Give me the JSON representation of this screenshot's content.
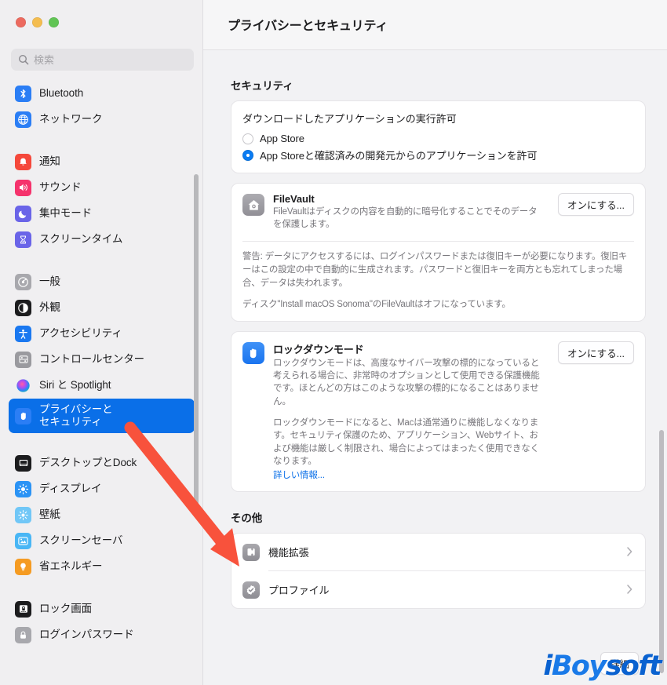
{
  "window": {
    "traffic_lights": [
      "close",
      "minimize",
      "maximize"
    ]
  },
  "sidebar": {
    "search": {
      "placeholder": "検索",
      "value": "",
      "icon": "search-icon"
    },
    "groups": [
      {
        "items": [
          {
            "label": "Bluetooth",
            "icon": "bluetooth-icon",
            "color": "#2b7ef5",
            "selected": false
          },
          {
            "label": "ネットワーク",
            "icon": "network-globe-icon",
            "color": "#2b7ef5",
            "selected": false
          }
        ]
      },
      {
        "items": [
          {
            "label": "通知",
            "icon": "bell-icon",
            "color": "#f5483b",
            "selected": false
          },
          {
            "label": "サウンド",
            "icon": "speaker-icon",
            "color": "#f5326c",
            "selected": false
          },
          {
            "label": "集中モード",
            "icon": "moon-icon",
            "color": "#6a64e8",
            "selected": false
          },
          {
            "label": "スクリーンタイム",
            "icon": "hourglass-icon",
            "color": "#6a64e8",
            "selected": false
          }
        ]
      },
      {
        "items": [
          {
            "label": "一般",
            "icon": "gear-icon",
            "color": "#a8a8ad",
            "selected": false
          },
          {
            "label": "外観",
            "icon": "appearance-icon",
            "color": "#1c1c1e",
            "selected": false
          },
          {
            "label": "アクセシビリティ",
            "icon": "accessibility-icon",
            "color": "#1a78f0",
            "selected": false
          },
          {
            "label": "コントロールセンター",
            "icon": "control-center-icon",
            "color": "#9a9a9f",
            "selected": false
          },
          {
            "label": "Siri と Spotlight",
            "icon": "siri-icon",
            "color": "#4a2a6a",
            "selected": false
          },
          {
            "label": "プライバシーと\nセキュリティ",
            "icon": "privacy-hand-icon",
            "color": "#2b7ef5",
            "selected": true
          }
        ]
      },
      {
        "items": [
          {
            "label": "デスクトップとDock",
            "icon": "desktop-dock-icon",
            "color": "#1c1c1e",
            "selected": false
          },
          {
            "label": "ディスプレイ",
            "icon": "display-icon",
            "color": "#2b93f5",
            "selected": false
          },
          {
            "label": "壁紙",
            "icon": "wallpaper-icon",
            "color": "#71c7f7",
            "selected": false
          },
          {
            "label": "スクリーンセーバ",
            "icon": "screensaver-icon",
            "color": "#49b6f5",
            "selected": false
          },
          {
            "label": "省エネルギー",
            "icon": "lightbulb-icon",
            "color": "#f59b22",
            "selected": false
          }
        ]
      },
      {
        "items": [
          {
            "label": "ロック画面",
            "icon": "lock-screen-icon",
            "color": "#1c1c1e",
            "selected": false
          },
          {
            "label": "ログインパスワード",
            "icon": "password-lock-icon",
            "color": "#a8a8ad",
            "selected": false
          }
        ]
      }
    ]
  },
  "main": {
    "title": "プライバシーとセキュリティ",
    "security_section": {
      "heading": "セキュリティ",
      "gatekeeper": {
        "title": "ダウンロードしたアプリケーションの実行許可",
        "options": [
          {
            "label": "App Store",
            "selected": false
          },
          {
            "label": "App Storeと確認済みの開発元からのアプリケーションを許可",
            "selected": true
          }
        ]
      },
      "filevault": {
        "icon": "filevault-house-icon",
        "name": "FileVault",
        "description": "FileVaultはディスクの内容を自動的に暗号化することでそのデータを保護します。",
        "button": "オンにする...",
        "notes": [
          "警告: データにアクセスするには、ログインパスワードまたは復旧キーが必要になります。復旧キーはこの設定の中で自動的に生成されます。パスワードと復旧キーを両方とも忘れてしまった場合、データは失われます。",
          "ディスク\"Install macOS Sonoma\"のFileVaultはオフになっています。"
        ]
      },
      "lockdown": {
        "icon": "lockdown-hand-icon",
        "name": "ロックダウンモード",
        "description": "ロックダウンモードは、高度なサイバー攻撃の標的になっていると考えられる場合に、非常時のオプションとして使用できる保護機能です。ほとんどの方はこのような攻撃の標的になることはありません。",
        "description2": "ロックダウンモードになると、Macは通常通りに機能しなくなります。セキュリティ保護のため、アプリケーション、Webサイト、および機能は厳しく制限され、場合によってはまったく使用できなくなります。",
        "link": "詳しい情報...",
        "button": "オンにする..."
      }
    },
    "others_section": {
      "heading": "その他",
      "rows": [
        {
          "label": "機能拡張",
          "icon": "extension-puzzle-icon",
          "chevron": "chevron-right-icon"
        },
        {
          "label": "プロファイル",
          "icon": "profile-check-icon",
          "chevron": "chevron-right-icon"
        }
      ]
    },
    "detail_button": "詳細"
  },
  "annotation": {
    "arrow_color": "#f8523c",
    "target": "機能拡張"
  },
  "watermark": {
    "text_i": "i",
    "text_boy": "Boy",
    "text_soft": "soft",
    "color": "#0a62d0"
  }
}
